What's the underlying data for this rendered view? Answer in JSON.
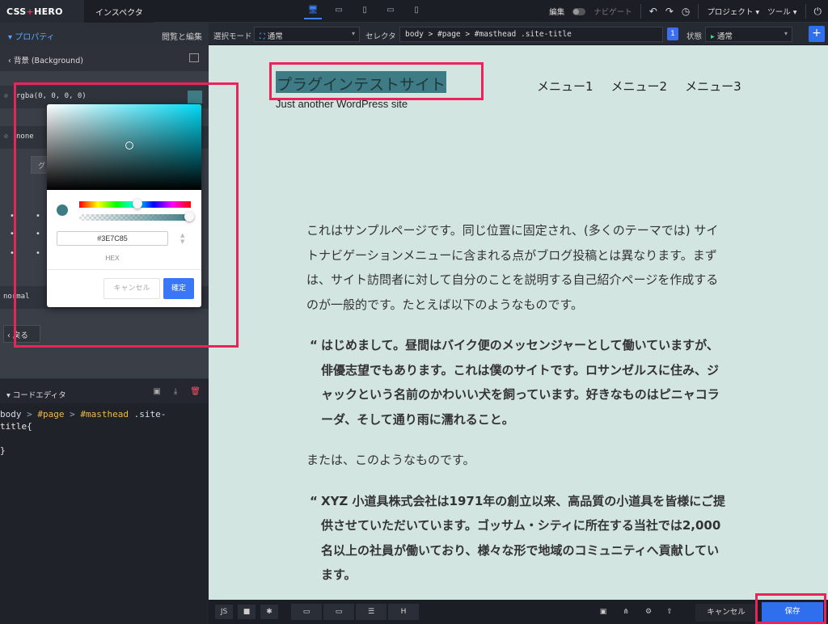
{
  "topbar": {
    "logo": "CSS",
    "logo_plus": "+",
    "logo_rest": "HERO",
    "tab": "インスペクタ",
    "edit": "編集",
    "navigate": "ナビゲート",
    "project": "プロジェクト",
    "tools": "ツール"
  },
  "secondbar": {
    "props": "プロパティ",
    "view_edit": "閲覧と編集",
    "mode_label": "選択モード",
    "mode_value": "通常",
    "selector_label": "セレクタ",
    "selector_value": "body > #page > #masthead .site-title",
    "count": "1",
    "state_label": "状態",
    "state_value": "通常"
  },
  "left": {
    "bg_title": "背景 (Background)",
    "color_value": "rgba(0, 0, 0, 0)",
    "none": "none",
    "g_btn": "グ",
    "normal": "normal",
    "back": "戻る"
  },
  "picker": {
    "hex": "#3E7C85",
    "hex_label": "HEX",
    "cancel": "キャンセル",
    "ok": "確定",
    "color": "#3e7c85"
  },
  "code": {
    "title": "コードエディタ",
    "l1_a": "body",
    "l1_b": " > ",
    "l1_c": "#page",
    "l1_d": " > ",
    "l1_e": "#masthead",
    "l1_f": " .site-",
    "l2": "title{",
    "l4": "}"
  },
  "site": {
    "title": "プラグインテストサイト",
    "tagline": "Just another WordPress site",
    "menu": [
      "メニュー1",
      "メニュー2",
      "メニュー3"
    ],
    "p1": "これはサンプルページです。同じ位置に固定され、(多くのテーマでは) サイトナビゲーションメニューに含まれる点がブログ投稿とは異なります。まずは、サイト訪問者に対して自分のことを説明する自己紹介ページを作成するのが一般的です。たとえば以下のようなものです。",
    "q1": "はじめまして。昼間はバイク便のメッセンジャーとして働いていますが、俳優志望でもあります。これは僕のサイトです。ロサンゼルスに住み、ジャックという名前のかわいい犬を飼っています。好きなものはピニャコラーダ、そして通り雨に濡れること。",
    "p2": "または、このようなものです。",
    "q2": "XYZ 小道具株式会社は1971年の創立以来、高品質の小道具を皆様にご提供させていただいています。ゴッサム・シティに所在する当社では2,000名以上の社員が働いており、様々な形で地域のコミュニティへ貢献しています。",
    "quote_mark": "“"
  },
  "bottom": {
    "js": "JS",
    "h": "H",
    "cancel": "キャンセル",
    "save": "保存"
  },
  "colors": {
    "accent": "#2f6fee",
    "highlight": "#e8245a",
    "site_bg": "#d3e5e1"
  }
}
